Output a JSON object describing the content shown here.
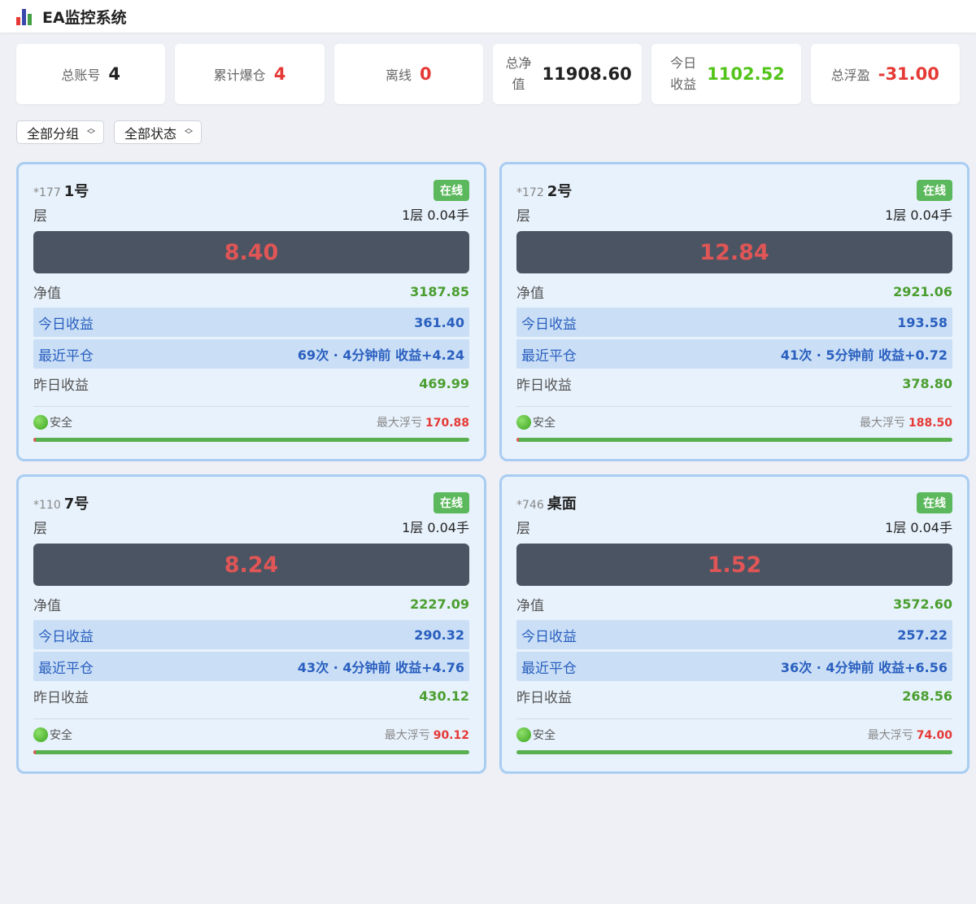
{
  "header": {
    "title": "EA监控系统"
  },
  "stats": [
    {
      "label": "总账号",
      "value": "4",
      "color": "#222222",
      "wrap": false
    },
    {
      "label": "累计爆仓",
      "value": "4",
      "color": "#e53935",
      "wrap": false
    },
    {
      "label": "离线",
      "value": "0",
      "color": "#e53935",
      "wrap": false
    },
    {
      "label": "总净值",
      "value": "11908.60",
      "color": "#222222",
      "wrap": true
    },
    {
      "label": "今日收益",
      "value": "1102.52",
      "color": "#52c41a",
      "wrap": true
    },
    {
      "label": "总浮盈",
      "value": "-31.00",
      "color": "#e53935",
      "wrap": false
    }
  ],
  "filters": {
    "group": "全部分组",
    "status": "全部状态"
  },
  "labels": {
    "layer": "层",
    "net": "净值",
    "today": "今日收益",
    "recent": "最近平仓",
    "yesterday": "昨日收益",
    "safe": "安全",
    "max_float": "最大浮亏"
  },
  "accounts": [
    {
      "id": "*177",
      "name": "1号",
      "status": "在线",
      "layer": "1层 0.04手",
      "float": "8.40",
      "net": "3187.85",
      "today": "361.40",
      "recent": "69次 · 4分钟前 收益+4.24",
      "yesterday": "469.99",
      "max_float": "170.88",
      "risk": 0.005
    },
    {
      "id": "*172",
      "name": "2号",
      "status": "在线",
      "layer": "1层 0.04手",
      "float": "12.84",
      "net": "2921.06",
      "today": "193.58",
      "recent": "41次 · 5分钟前 收益+0.72",
      "yesterday": "378.80",
      "max_float": "188.50",
      "risk": 0.005
    },
    {
      "id": "*110",
      "name": "7号",
      "status": "在线",
      "layer": "1层 0.04手",
      "float": "8.24",
      "net": "2227.09",
      "today": "290.32",
      "recent": "43次 · 4分钟前 收益+4.76",
      "yesterday": "430.12",
      "max_float": "90.12",
      "risk": 0.005
    },
    {
      "id": "*746",
      "name": "桌面",
      "status": "在线",
      "layer": "1层 0.04手",
      "float": "1.52",
      "net": "3572.60",
      "today": "257.22",
      "recent": "36次 · 4分钟前 收益+6.56",
      "yesterday": "268.56",
      "max_float": "74.00",
      "risk": 0.0
    }
  ]
}
